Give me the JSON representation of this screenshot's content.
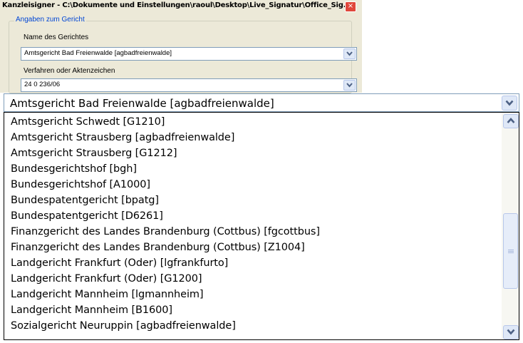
{
  "window": {
    "title": "Kanzleisigner - C:\\Dokumente und Einstellungen\\raoul\\Desktop\\Live_Signatur\\Office_Sig...",
    "close_glyph": "×"
  },
  "group": {
    "title": "Angaben zum Gericht",
    "court_label": "Name des Gerichtes",
    "court_value": "Amtsgericht Bad Freienwalde [agbadfreienwalde]",
    "case_label": "Verfahren oder Aktenzeichen",
    "case_value": "24 0 236/06"
  },
  "dropdown": {
    "selected": "Amtsgericht Bad Freienwalde [agbadfreienwalde]",
    "items": [
      "Amtsgericht Schwedt [G1210]",
      "Amtsgericht Strausberg [agbadfreienwalde]",
      "Amtsgericht Strausberg [G1212]",
      "Bundesgerichtshof [bgh]",
      "Bundesgerichtshof [A1000]",
      "Bundespatentgericht [bpatg]",
      "Bundespatentgericht [D6261]",
      "Finanzgericht des Landes Brandenburg (Cottbus) [fgcottbus]",
      "Finanzgericht des Landes Brandenburg (Cottbus) [Z1004]",
      "Landgericht Frankfurt (Oder) [lgfrankfurto]",
      "Landgericht Frankfurt (Oder) [G1200]",
      "Landgericht Mannheim [lgmannheim]",
      "Landgericht Mannheim [B1600]",
      "Sozialgericht Neuruppin [agbadfreienwalde]"
    ]
  },
  "icons": {
    "combo_arrow": "chevron-down-icon",
    "scroll_up": "chevron-up-icon",
    "scroll_down": "chevron-down-icon",
    "thumb_grip": "grip-icon"
  },
  "colors": {
    "window_bg": "#ece9d8",
    "group_title": "#0046d5",
    "close_button": "#e0473b",
    "input_border": "#7f9db9",
    "button_face": "#dfe8f7"
  }
}
